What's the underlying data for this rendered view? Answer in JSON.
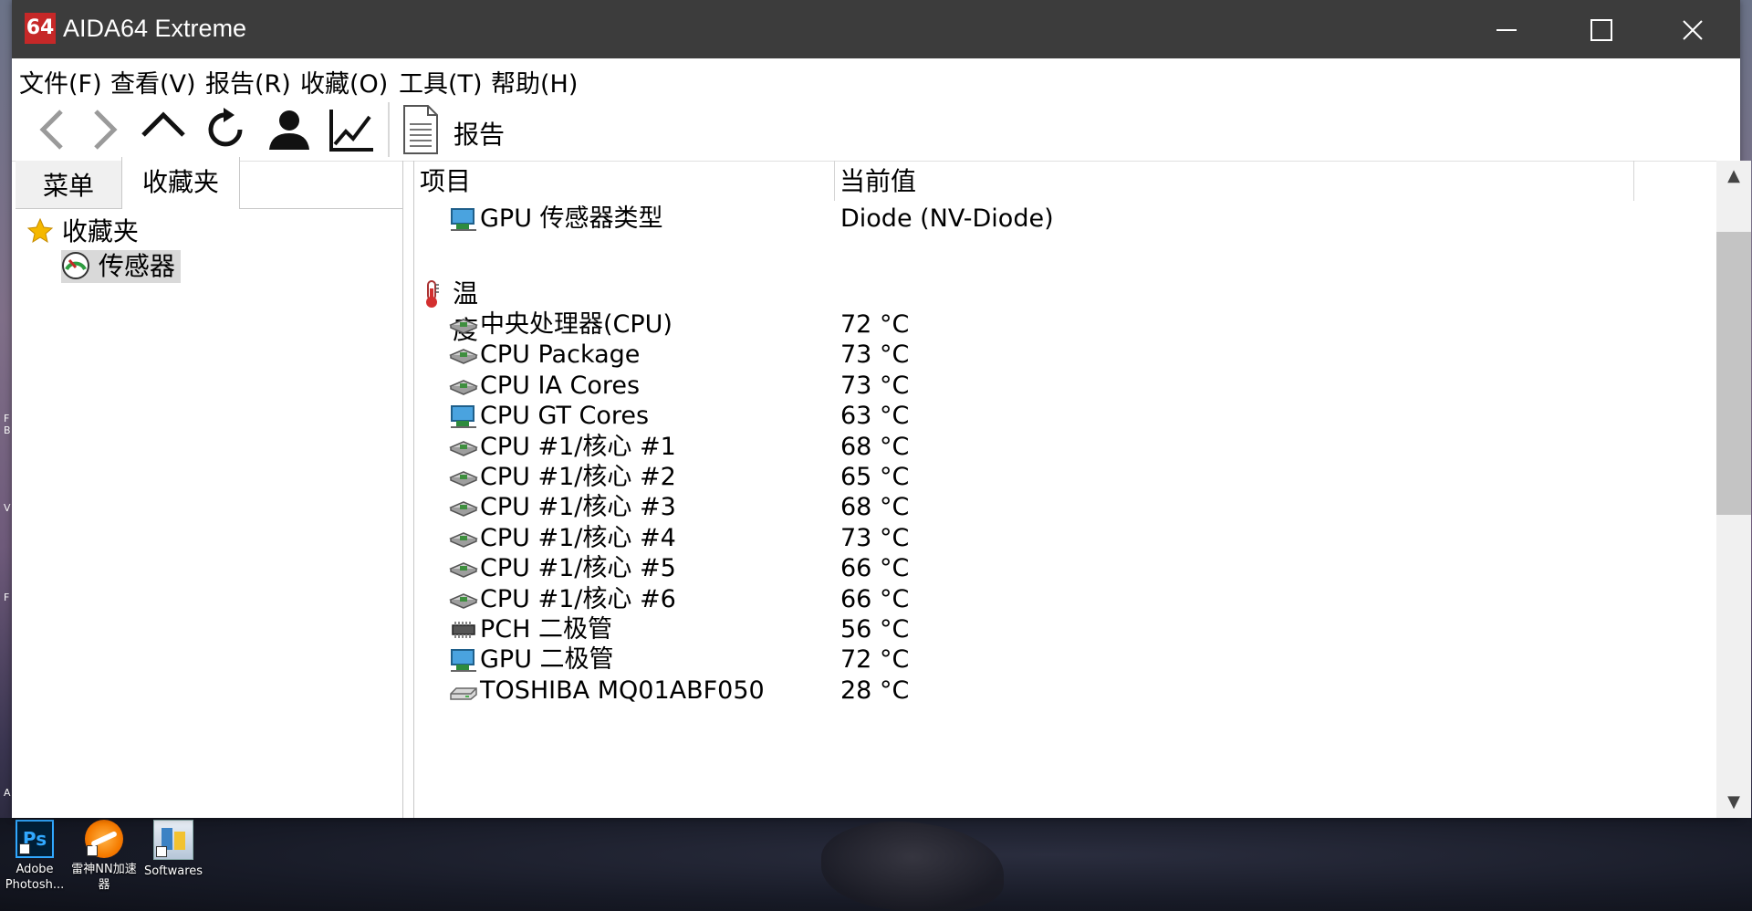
{
  "window": {
    "app_logo": "64",
    "title": "AIDA64 Extreme"
  },
  "menubar": {
    "items": [
      "文件(F)",
      "查看(V)",
      "报告(R)",
      "收藏(O)",
      "工具(T)",
      "帮助(H)"
    ]
  },
  "toolbar": {
    "buttons": [
      "back-icon",
      "forward-icon",
      "up-icon",
      "refresh-icon",
      "user-icon",
      "chart-icon"
    ],
    "report_label": "报告"
  },
  "left_pane": {
    "tabs": [
      "菜单",
      "收藏夹"
    ],
    "active_tab": "收藏夹",
    "tree": [
      {
        "label": "收藏夹",
        "icon": "star-icon"
      },
      {
        "label": "传感器",
        "icon": "gauge-icon",
        "selected": true
      }
    ]
  },
  "table": {
    "columns": [
      "项目",
      "当前值"
    ],
    "top_row": {
      "label": "GPU 传感器类型",
      "value": "Diode  (NV-Diode)",
      "icon": "gpu-icon"
    },
    "group": {
      "title": "温度",
      "icon": "thermometer-icon"
    },
    "rows": [
      {
        "label": "中央处理器(CPU)",
        "value": "72 °C",
        "icon": "cpu-icon"
      },
      {
        "label": "CPU Package",
        "value": "73 °C",
        "icon": "cpu-icon"
      },
      {
        "label": "CPU IA Cores",
        "value": "73 °C",
        "icon": "cpu-icon"
      },
      {
        "label": "CPU GT Cores",
        "value": "63 °C",
        "icon": "gpu-icon"
      },
      {
        "label": "CPU #1/核心 #1",
        "value": "68 °C",
        "icon": "cpu-icon"
      },
      {
        "label": "CPU #1/核心 #2",
        "value": "65 °C",
        "icon": "cpu-icon"
      },
      {
        "label": "CPU #1/核心 #3",
        "value": "68 °C",
        "icon": "cpu-icon"
      },
      {
        "label": "CPU #1/核心 #4",
        "value": "73 °C",
        "icon": "cpu-icon"
      },
      {
        "label": "CPU #1/核心 #5",
        "value": "66 °C",
        "icon": "cpu-icon"
      },
      {
        "label": "CPU #1/核心 #6",
        "value": "66 °C",
        "icon": "cpu-icon"
      },
      {
        "label": "PCH 二极管",
        "value": "56 °C",
        "icon": "chip-icon"
      },
      {
        "label": "GPU 二极管",
        "value": "72 °C",
        "icon": "gpu-icon"
      },
      {
        "label": "TOSHIBA MQ01ABF050",
        "value": "28 °C",
        "icon": "hdd-icon"
      }
    ]
  },
  "desktop": {
    "icons": [
      {
        "label": "Adobe Photosh...",
        "icon": "photoshop-icon"
      },
      {
        "label": "雷神NN加速器",
        "icon": "nn-accelerator-icon"
      },
      {
        "label": "Softwares",
        "icon": "softwares-folder-icon"
      }
    ]
  },
  "colors": {
    "titlebar": "#3c3c3c",
    "logo": "#c62828",
    "selection": "#d9d9d9"
  }
}
